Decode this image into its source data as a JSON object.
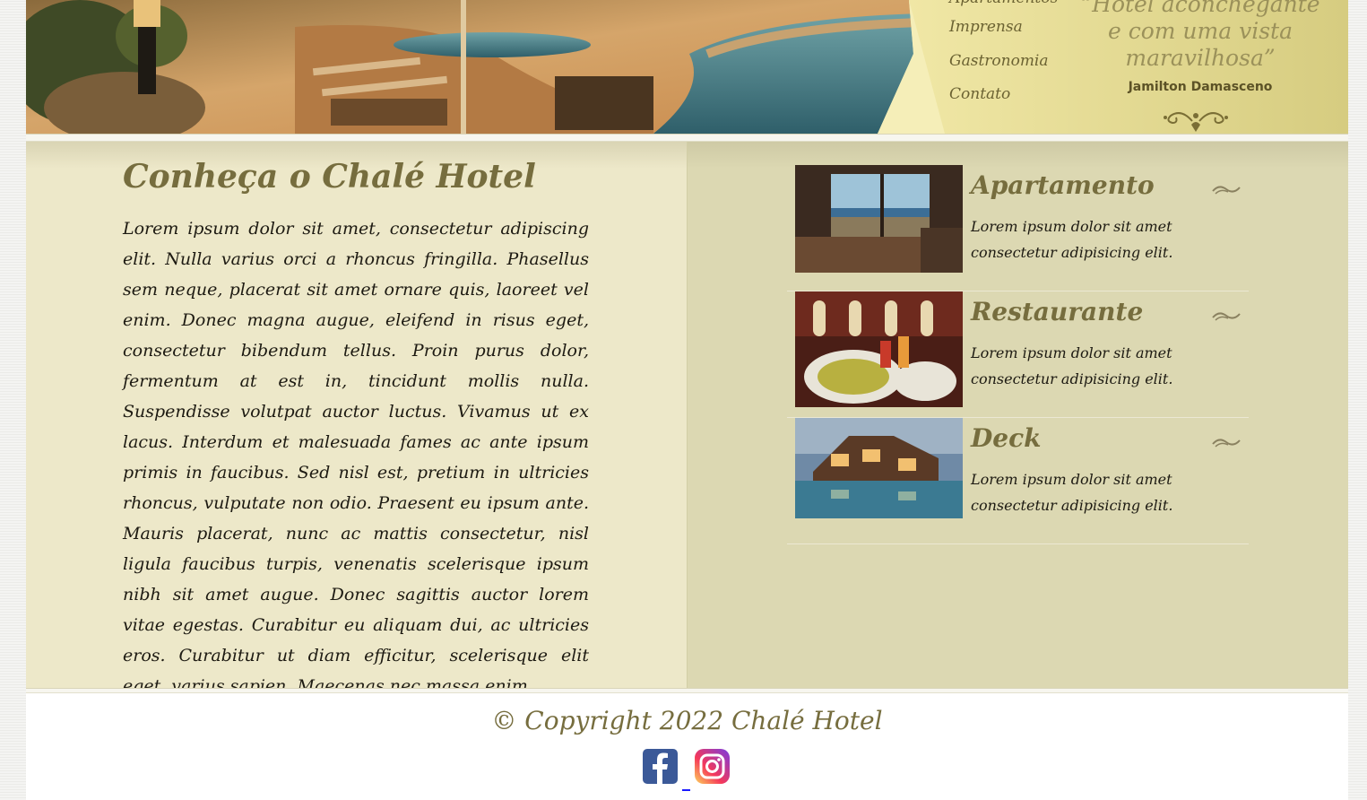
{
  "header": {
    "nav": {
      "item_1": "Apartamentos",
      "imprensa": "Imprensa",
      "gastronomia": "Gastronomia",
      "contato": "Contato"
    },
    "quote_line_1": "“Hotel aconchegante",
    "quote_line_2": "e com uma vista",
    "quote_line_3": "maravilhosa”",
    "quote_author": "Jamilton Damasceno"
  },
  "intro": {
    "title": "Conheça o Chalé Hotel",
    "text": "Lorem ipsum dolor sit amet, consectetur adipiscing elit. Nulla varius orci a rhoncus fringilla. Phasellus sem neque, placerat sit amet ornare quis, laoreet vel enim. Donec magna augue, eleifend in risus eget, consectetur bibendum tellus. Proin purus dolor, fermentum at est in, tincidunt mollis nulla. Suspendisse volutpat auctor luctus. Vivamus ut ex lacus. Interdum et malesuada fames ac ante ipsum primis in faucibus. Sed nisl est, pretium in ultricies rhoncus, vulputate non odio. Praesent eu ipsum ante. Mauris placerat, nunc ac mattis consectetur, nisl ligula faucibus turpis, venenatis scelerisque ipsum nibh sit amet augue. Donec sagittis auctor lorem vitae egestas. Curabitur eu aliquam dui, ac ultricies eros. Curabitur ut diam efficitur, scelerisque elit eget, varius sapien. Maecenas nec massa enim."
  },
  "cards": [
    {
      "title": "Apartamento",
      "text": "Lorem ipsum dolor sit amet consectetur adipisicing elit."
    },
    {
      "title": "Restaurante",
      "text": "Lorem ipsum dolor sit amet consectetur adipisicing elit."
    },
    {
      "title": "Deck",
      "text": "Lorem ipsum dolor sit amet consectetur adipisicing elit."
    }
  ],
  "footer": {
    "copyright": "© Copyright 2022 Chalé Hotel",
    "social": [
      "facebook-icon",
      "instagram-icon"
    ]
  },
  "colors": {
    "accent_olive": "#766d3e",
    "panel_left": "#ede8c9",
    "panel_right": "#dcd8b2",
    "header_gold": "#d8cf86",
    "facebook_blue": "#3b5998"
  }
}
